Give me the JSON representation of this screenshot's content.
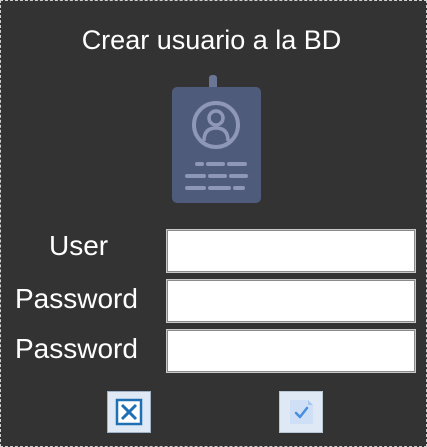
{
  "dialog": {
    "title": "Crear usuario a la BD"
  },
  "icons": {
    "badge": "id-badge-icon",
    "cancel": "close-x-icon",
    "confirm": "checkmark-icon"
  },
  "form": {
    "user_label": "User",
    "user_value": "",
    "password_label": "Password",
    "password_value": "",
    "confirm_password_label": "Password",
    "confirm_password_value": ""
  },
  "colors": {
    "background": "#333333",
    "badge": "#4f5b7a",
    "badge_detail": "#8e97b8",
    "button_face": "#dfe9f5",
    "cancel_accent": "#1f6fb5",
    "confirm_accent": "#4a8ee0"
  }
}
